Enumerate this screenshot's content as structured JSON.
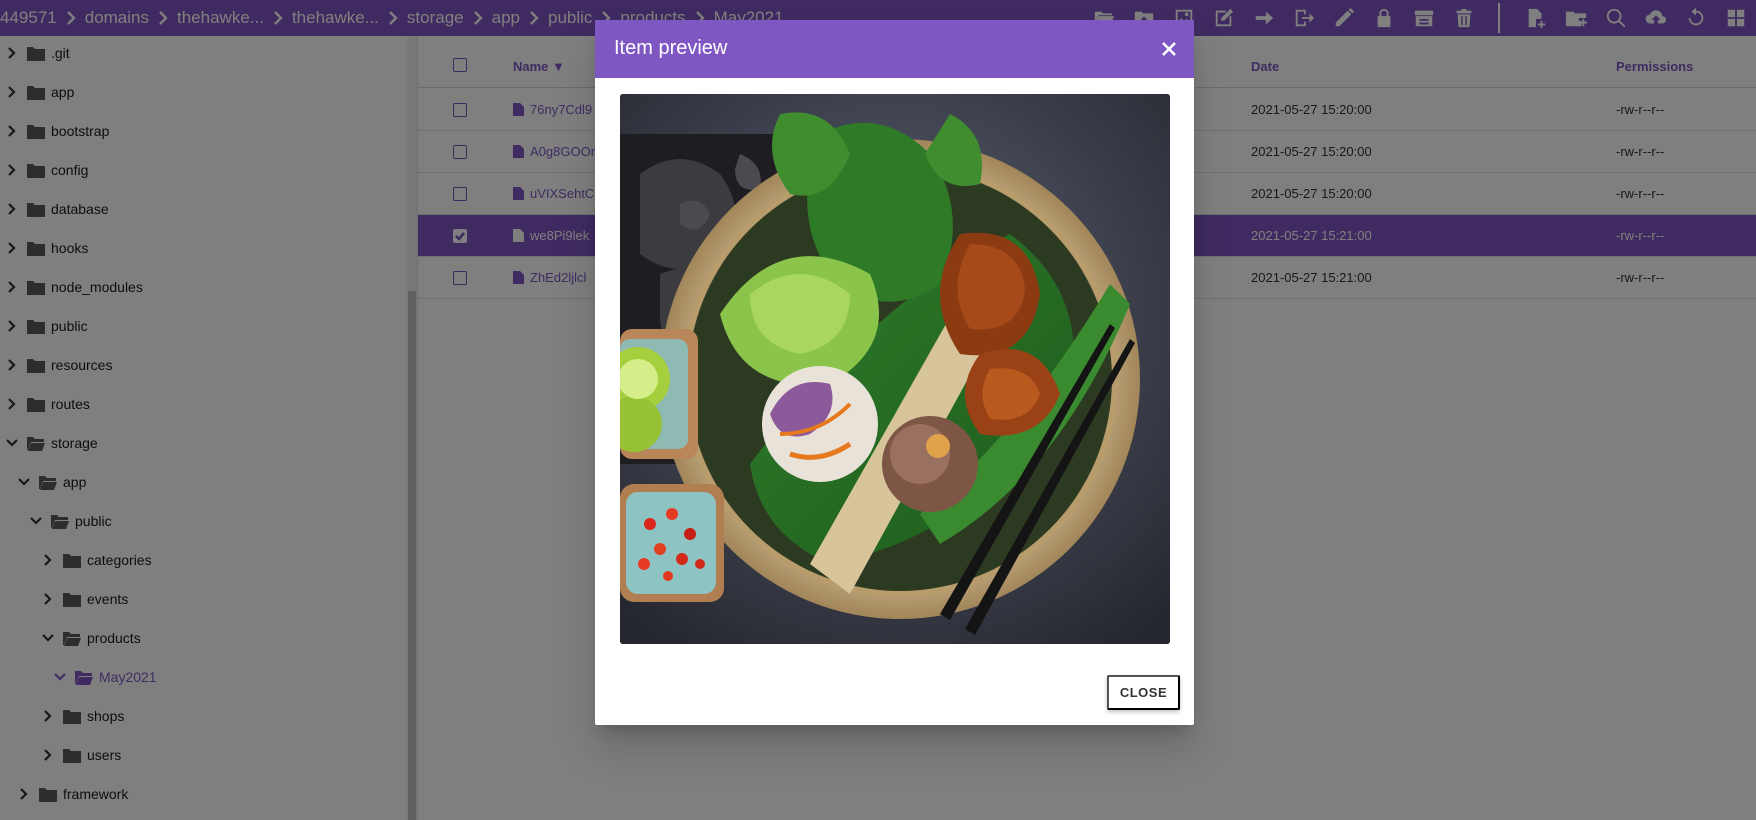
{
  "breadcrumb": [
    "449571",
    "domains",
    "thehawke...",
    "thehawke...",
    "storage",
    "app",
    "public",
    "products",
    "May2021"
  ],
  "toolbar": {
    "left_icons": [
      "folder-open-icon",
      "cloud-folder-icon",
      "image-icon",
      "edit-icon",
      "arrow-right-icon",
      "logout-icon",
      "pencil-icon",
      "lock-icon",
      "archive-icon",
      "trash-icon"
    ],
    "right_icons": [
      "new-file-icon",
      "new-folder-icon",
      "search-icon",
      "upload-icon",
      "refresh-icon",
      "grid-icon"
    ]
  },
  "sidebar": {
    "items": [
      {
        "label": ".git",
        "level": 0,
        "expanded": false
      },
      {
        "label": "app",
        "level": 0,
        "expanded": false
      },
      {
        "label": "bootstrap",
        "level": 0,
        "expanded": false
      },
      {
        "label": "config",
        "level": 0,
        "expanded": false
      },
      {
        "label": "database",
        "level": 0,
        "expanded": false
      },
      {
        "label": "hooks",
        "level": 0,
        "expanded": false
      },
      {
        "label": "node_modules",
        "level": 0,
        "expanded": false
      },
      {
        "label": "public",
        "level": 0,
        "expanded": false
      },
      {
        "label": "resources",
        "level": 0,
        "expanded": false
      },
      {
        "label": "routes",
        "level": 0,
        "expanded": false
      },
      {
        "label": "storage",
        "level": 0,
        "expanded": true
      },
      {
        "label": "app",
        "level": 1,
        "expanded": true
      },
      {
        "label": "public",
        "level": 2,
        "expanded": true
      },
      {
        "label": "categories",
        "level": 3,
        "expanded": false
      },
      {
        "label": "events",
        "level": 3,
        "expanded": false
      },
      {
        "label": "products",
        "level": 3,
        "expanded": true
      },
      {
        "label": "May2021",
        "level": 4,
        "expanded": true,
        "active": true
      },
      {
        "label": "shops",
        "level": 3,
        "expanded": false
      },
      {
        "label": "users",
        "level": 3,
        "expanded": false
      },
      {
        "label": "framework",
        "level": 1,
        "expanded": false
      }
    ]
  },
  "table": {
    "columns": {
      "name": "Name ▼",
      "date": "Date",
      "permissions": "Permissions"
    },
    "rows": [
      {
        "name": "76ny7Cdl9",
        "date": "2021-05-27 15:20:00",
        "permissions": "-rw-r--r--",
        "selected": false
      },
      {
        "name": "A0g8GOOr",
        "date": "2021-05-27 15:20:00",
        "permissions": "-rw-r--r--",
        "selected": false
      },
      {
        "name": "uVIXSehtC",
        "date": "2021-05-27 15:20:00",
        "permissions": "-rw-r--r--",
        "selected": false
      },
      {
        "name": "we8Pi9lek",
        "date": "2021-05-27 15:21:00",
        "permissions": "-rw-r--r--",
        "selected": true
      },
      {
        "name": "ZhEd2ljlcl",
        "date": "2021-05-27 15:21:00",
        "permissions": "-rw-r--r--",
        "selected": false
      }
    ]
  },
  "dialog": {
    "title": "Item preview",
    "close_label": "CLOSE"
  },
  "colors": {
    "accent": "#7e57c2",
    "overlay": "rgba(0,0,0,0.5)"
  }
}
